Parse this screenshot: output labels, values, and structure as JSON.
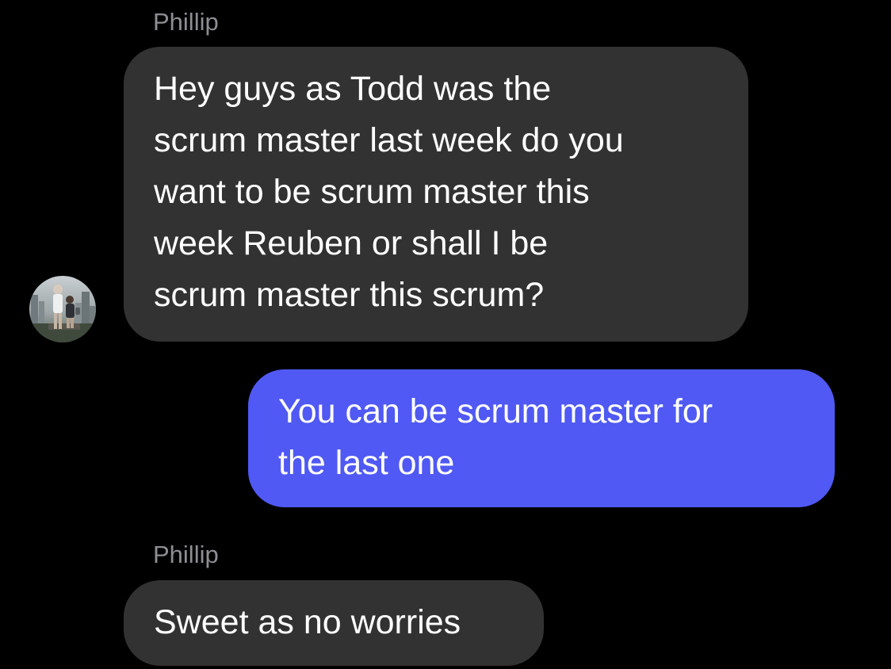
{
  "conversation": {
    "messages": [
      {
        "direction": "incoming",
        "sender": "Phillip",
        "avatar_icon": "contact-photo",
        "text": "Hey guys as Todd was the\nscrum master last week do you\nwant to be scrum master this\nweek Reuben or shall I  be\nscrum master this scrum?"
      },
      {
        "direction": "outgoing",
        "text": "You can be scrum master for\nthe last one"
      },
      {
        "direction": "incoming",
        "sender": "Phillip",
        "text": "Sweet as no worries"
      }
    ]
  },
  "colors": {
    "background": "#000000",
    "incoming_bubble": "#323232",
    "outgoing_bubble": "#5059f4",
    "sender_name": "#8e8e93",
    "message_text": "#ffffff"
  }
}
